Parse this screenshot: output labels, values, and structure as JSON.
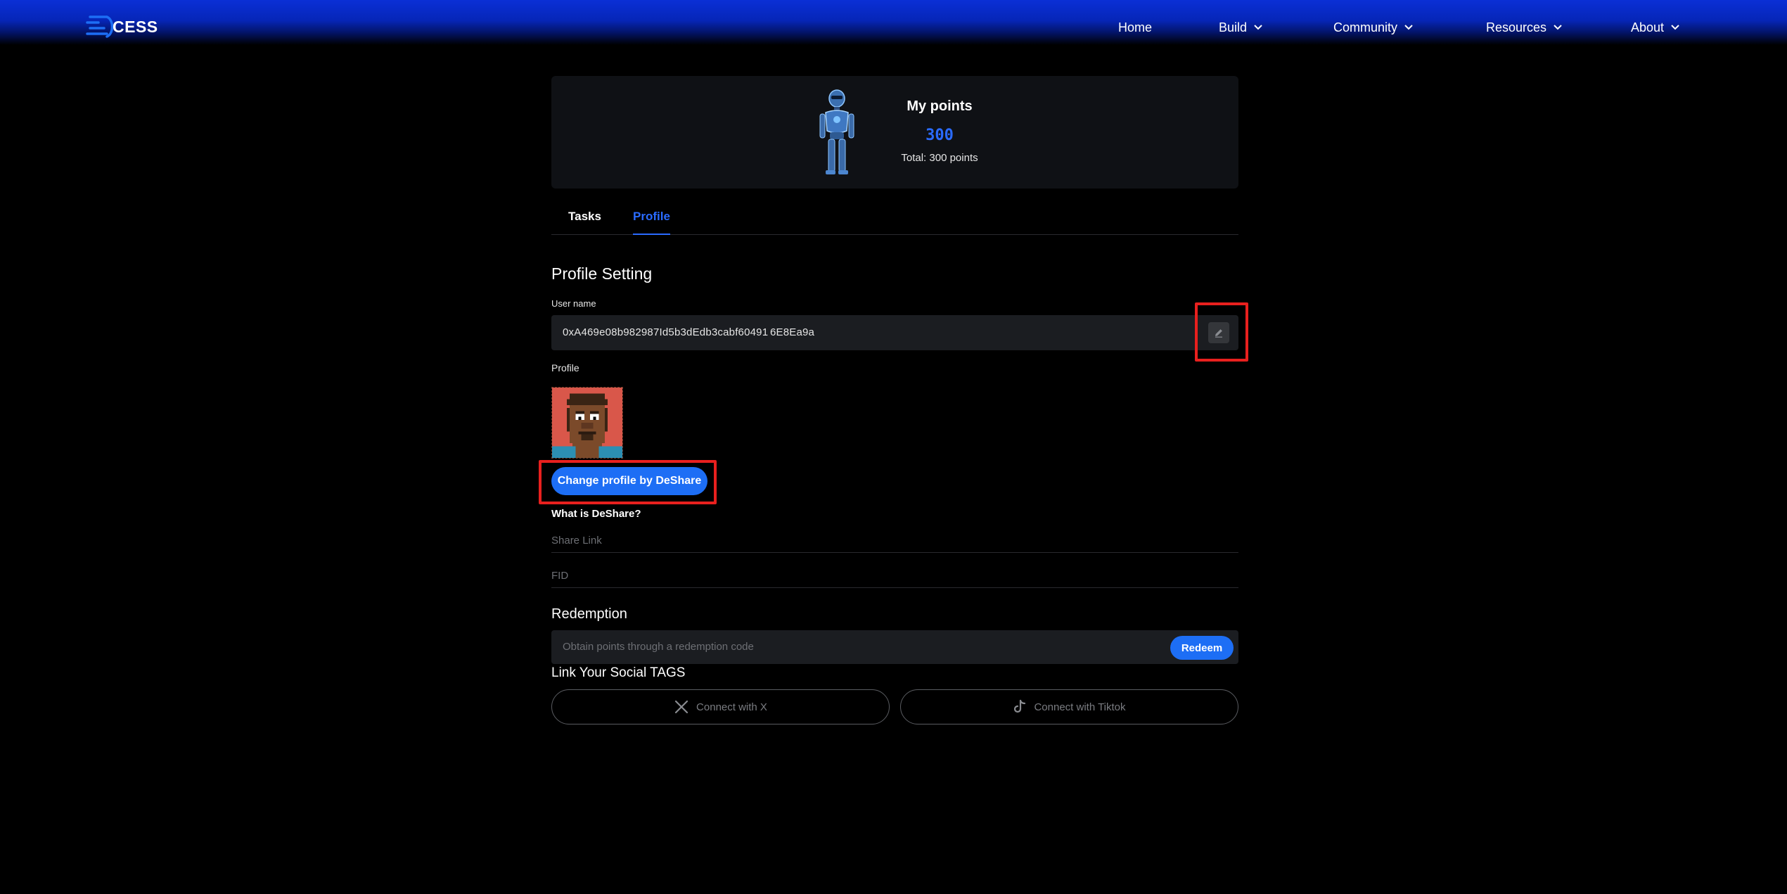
{
  "header": {
    "logo_text": "CESS",
    "nav": [
      {
        "label": "Home",
        "has_dropdown": false
      },
      {
        "label": "Build",
        "has_dropdown": true
      },
      {
        "label": "Community",
        "has_dropdown": true
      },
      {
        "label": "Resources",
        "has_dropdown": true
      },
      {
        "label": "About",
        "has_dropdown": true
      }
    ]
  },
  "points": {
    "title": "My points",
    "value": "300",
    "total": "Total: 300 points"
  },
  "tabs": [
    {
      "label": "Tasks",
      "active": false
    },
    {
      "label": "Profile",
      "active": true
    }
  ],
  "profile": {
    "section_title": "Profile Setting",
    "username_label": "User name",
    "username_value": "0xA469e08b982987Id5b3dEdb3cabf60491 6E8Ea9a",
    "profile_label": "Profile",
    "change_button": "Change profile by DeShare",
    "what_is_link": "What is DeShare?",
    "share_link_placeholder": "Share Link",
    "fid_placeholder": "FID"
  },
  "redemption": {
    "title": "Redemption",
    "placeholder": "Obtain points through a redemption code",
    "button": "Redeem"
  },
  "social": {
    "title": "Link Your Social TAGS",
    "x_button": "Connect with X",
    "tiktok_button": "Connect with Tiktok"
  },
  "colors": {
    "accent": "#1d6ef5",
    "points": "#2a6bff",
    "highlight": "#e8201e",
    "background": "#000000"
  }
}
